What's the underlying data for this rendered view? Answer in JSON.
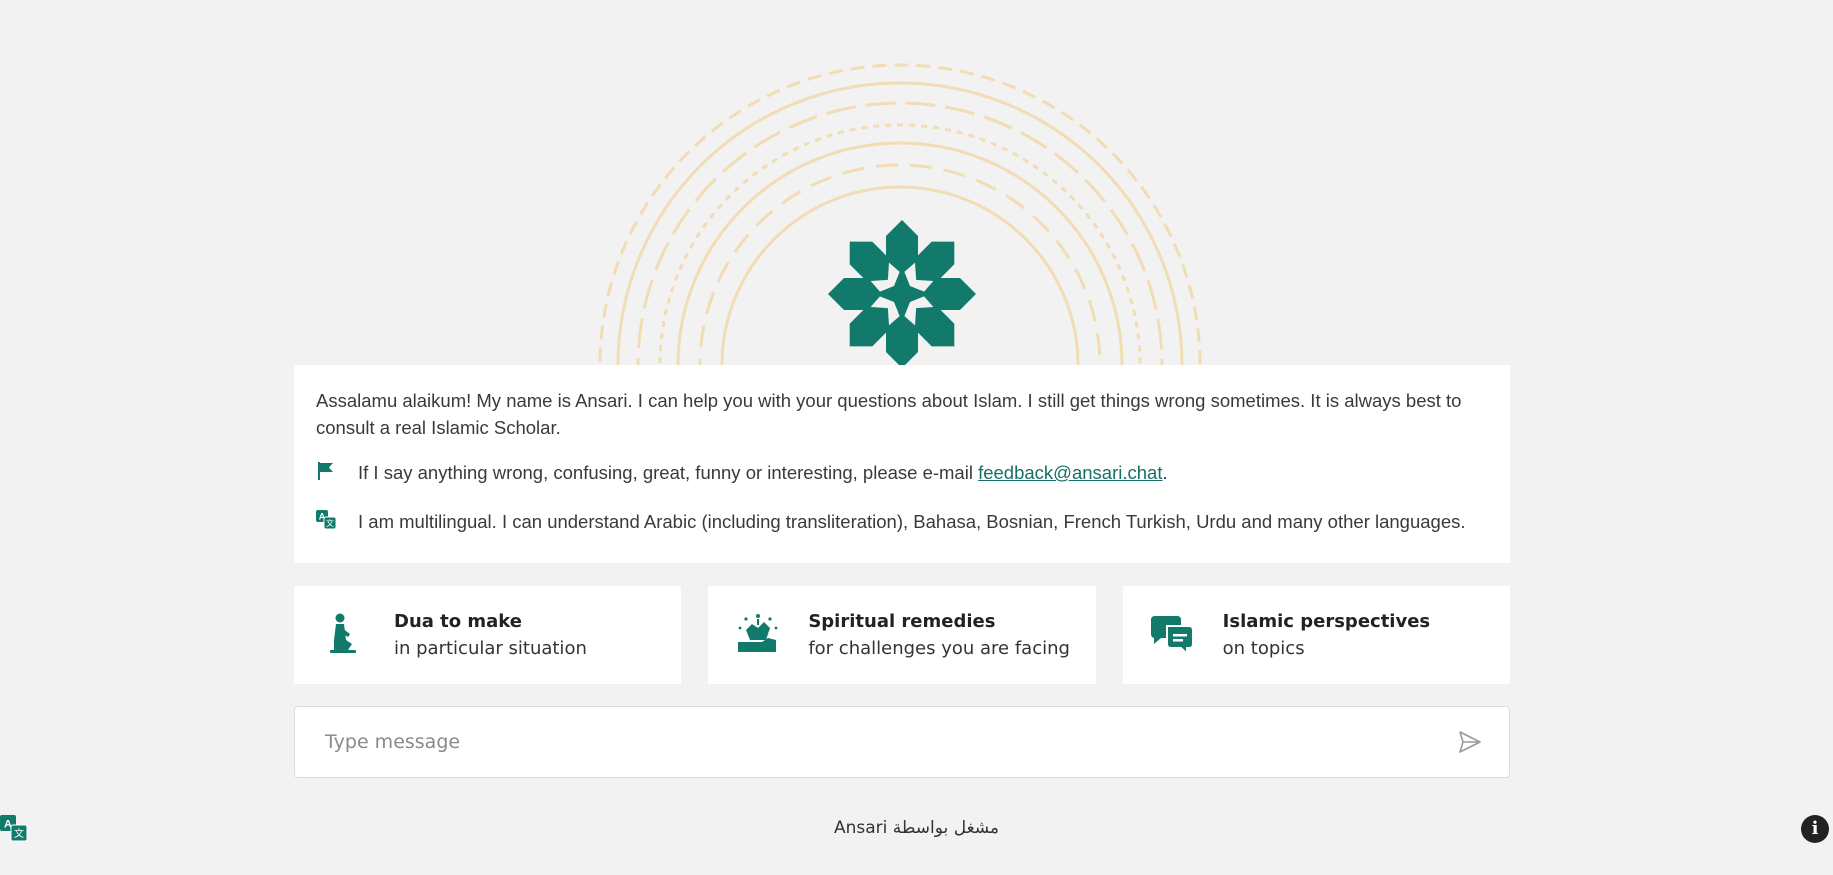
{
  "colors": {
    "brand": "#117a6b",
    "mandala": "#f1dcb4",
    "background": "#f2f2f2"
  },
  "intro": {
    "greeting": "Assalamu alaikum! My name is Ansari. I can help you with your questions about Islam. I still get things wrong sometimes. It is always best to consult a real Islamic Scholar.",
    "feedback_prefix": "If I say anything wrong, confusing, great, funny or interesting, please e-mail ",
    "feedback_email": "feedback@ansari.chat",
    "feedback_suffix": ".",
    "multilingual": "I am multilingual. I can understand Arabic (including transliteration), Bahasa, Bosnian, French Turkish, Urdu and many other languages.",
    "feedback_icon": "flag-icon",
    "multilingual_icon": "translate-icon"
  },
  "cards": [
    {
      "title": "Dua to make",
      "subtitle": "in particular situation",
      "icon": "praying-person-icon"
    },
    {
      "title": "Spiritual remedies",
      "subtitle": "for challenges you are facing",
      "icon": "raised-hands-icon"
    },
    {
      "title": "Islamic perspectives",
      "subtitle": "on topics",
      "icon": "chat-bubbles-icon"
    }
  ],
  "composer": {
    "placeholder": "Type message",
    "send_icon": "send-icon"
  },
  "footer": {
    "text": "Ansari مشغل بواسطة"
  },
  "corner": {
    "language_icon": "translate-icon",
    "info_label": "i"
  }
}
